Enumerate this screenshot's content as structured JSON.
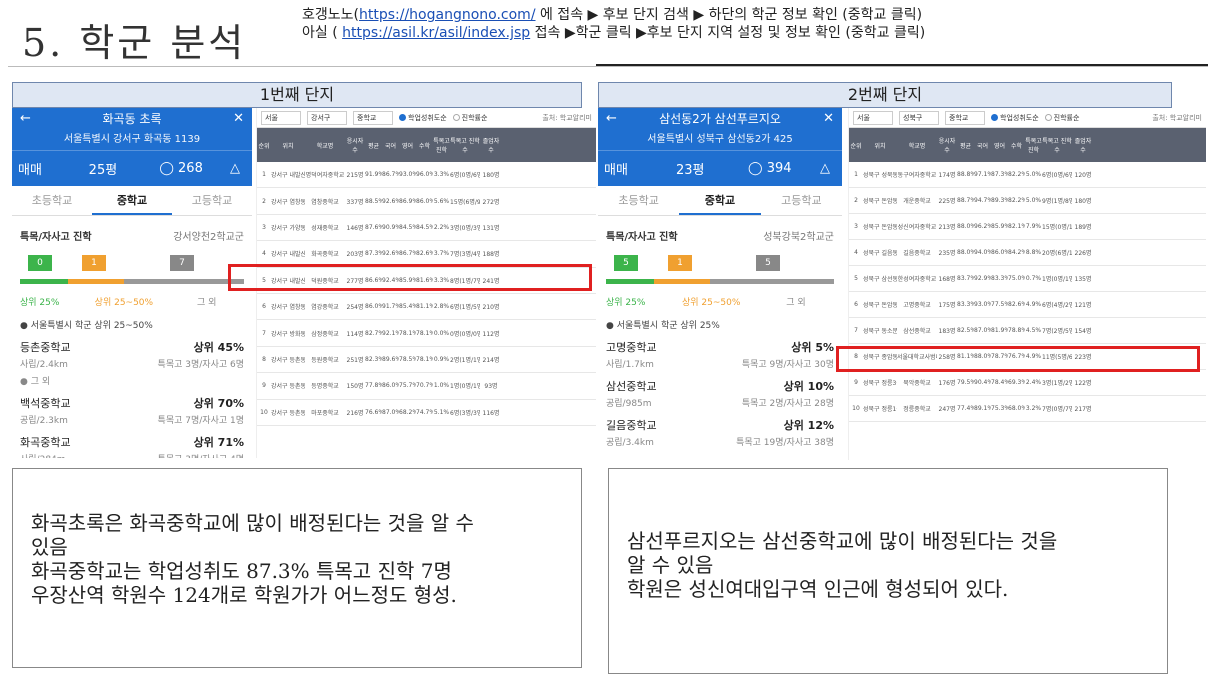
{
  "title": "5. 학군 분석",
  "instructions": {
    "line1_pre": "호갱노노(",
    "line1_link": "https://hogangnono.com/",
    "line1_post": " 에 접속 ▶ 후보 단지 검색 ▶ 하단의 학군 정보 확인 (중학교 클릭)",
    "line2_pre": "아실 ( ",
    "line2_link": "https://asil.kr/asil/index.jsp",
    "line2_post": " 접속 ▶학군 클릭 ▶후보 단지 지역 설정 및 정보 확인 (중학교 클릭)"
  },
  "colors": {
    "accent": "#1f6fd0",
    "highlight": "#e02020",
    "green": "#3cb44b",
    "orange": "#f0a030"
  },
  "panels": [
    {
      "band": "1번째 단지",
      "app": {
        "back": "←",
        "name": "화곡동 초록",
        "close": "✕",
        "address": "서울특별시 강서구 화곡동 1139",
        "deal": "매매",
        "size": "25평",
        "comments": "268",
        "search_icon": "magnifier",
        "bell_icon": "bell",
        "tabs": [
          "초등학교",
          "중학교",
          "고등학교"
        ],
        "section_left": "특목/자사고 진학",
        "section_right": "강서양천2학교군",
        "chips": [
          "0",
          "1",
          "7"
        ],
        "bar_labels": [
          "상위 25%",
          "상위 25~50%",
          "그 외"
        ],
        "note": "● 서울특별시 학군 상위 25~50%",
        "schools": [
          {
            "name": "등촌중학교",
            "rank": "상위 45%",
            "type": "사립/2.4km",
            "info": "특목고 3명/자사고 6명"
          },
          {
            "group": "● 그 외"
          },
          {
            "name": "백석중학교",
            "rank": "상위 70%",
            "type": "공립/2.3km",
            "info": "특목고 7명/자사고 1명"
          },
          {
            "name": "화곡중학교",
            "rank": "상위 71%",
            "type": "사립/284m",
            "info": "특목고 3명/자사고 4명"
          }
        ]
      },
      "table": {
        "region": "서울",
        "district": "강서구",
        "level": "중학교",
        "radio_on": "학업성취도순",
        "radio_off": "진학률순",
        "source": "출처: 학교알리미",
        "headers": [
          "순위",
          "위치",
          "학교명",
          "응시자수",
          "평균",
          "국어",
          "영어",
          "수학",
          "특목고진학",
          "특목고 진학수",
          "졸업자 수"
        ],
        "rows": [
          [
            "1",
            "강서구 내발산동",
            "명덕여자중학교",
            "215명",
            "91.9%",
            "86.7%",
            "93.0%",
            "96.0%",
            "3.3%",
            "6명(0명/6명)",
            "180명"
          ],
          [
            "2",
            "강서구 염창동",
            "염창중학교",
            "337명",
            "88.5%",
            "92.6%",
            "86.9%",
            "86.0%",
            "5.6%",
            "15명(6명/9명)",
            "272명"
          ],
          [
            "3",
            "강서구 가양동",
            "성재중학교",
            "146명",
            "87.6%",
            "90.9%",
            "84.5%",
            "84.5%",
            "2.2%",
            "3명(0명/3명)",
            "131명"
          ],
          [
            "4",
            "강서구 내발산동",
            "화곡중학교",
            "203명",
            "87.3%",
            "92.6%",
            "86.7%",
            "82.6%",
            "3.7%",
            "7명(3명/4명)",
            "188명"
          ],
          [
            "5",
            "강서구 내발산1동",
            "덕원중학교",
            "277명",
            "86.6%",
            "92.4%",
            "85.9%",
            "81.6%",
            "3.3%",
            "8명(1명/7명)",
            "241명"
          ],
          [
            "6",
            "강서구 염창동",
            "염강중학교",
            "254명",
            "86.0%",
            "91.7%",
            "85.4%",
            "81.1%",
            "2.8%",
            "6명(1명/5명)",
            "210명"
          ],
          [
            "7",
            "강서구 방화동",
            "삼정중학교",
            "114명",
            "82.7%",
            "92.1%",
            "78.1%",
            "78.1%",
            "0.0%",
            "0명(0명/0명)",
            "112명"
          ],
          [
            "8",
            "강서구 등촌동",
            "등원중학교",
            "251명",
            "82.3%",
            "89.6%",
            "78.5%",
            "78.1%",
            "0.9%",
            "2명(1명/1명)",
            "214명"
          ],
          [
            "9",
            "강서구 등촌동",
            "등명중학교",
            "150명",
            "77.8%",
            "86.0%",
            "75.7%",
            "70.7%",
            "1.0%",
            "1명(0명/1명)",
            "93명"
          ],
          [
            "10",
            "강서구 등촌동",
            "마포중학교",
            "216명",
            "76.6%",
            "87.0%",
            "68.2%",
            "74.7%",
            "5.1%",
            "6명(3명/3명)",
            "116명"
          ]
        ],
        "highlight_index": 3
      },
      "comment": [
        "화곡초록은 화곡중학교에 많이 배정된다는 것을 알 수",
        "있음",
        "화곡중학교는 학업성취도 87.3% 특목고 진학 7명",
        "우장산역 학원수 124개로 학원가가 어느정도 형성."
      ]
    },
    {
      "band": "2번째 단지",
      "app": {
        "back": "←",
        "name": "삼선동2가 삼선푸르지오",
        "close": "✕",
        "address": "서울특별시 성북구 삼선동2가 425",
        "deal": "매매",
        "size": "23평",
        "comments": "394",
        "search_icon": "magnifier",
        "bell_icon": "bell",
        "tabs": [
          "초등학교",
          "중학교",
          "고등학교"
        ],
        "section_left": "특목/자사고 진학",
        "section_right": "성북강북2학교군",
        "chips": [
          "5",
          "1",
          "5"
        ],
        "bar_labels": [
          "상위 25%",
          "상위 25~50%",
          "그 외"
        ],
        "note": "● 서울특별시 학군 상위 25%",
        "schools": [
          {
            "name": "고명중학교",
            "rank": "상위 5%",
            "type": "사립/1.7km",
            "info": "특목고 9명/자사고 30명"
          },
          {
            "name": "삼선중학교",
            "rank": "상위 10%",
            "type": "공립/985m",
            "info": "특목고 2명/자사고 28명"
          },
          {
            "name": "길음중학교",
            "rank": "상위 12%",
            "type": "공립/3.4km",
            "info": "특목고 19명/자사고 38명"
          }
        ]
      },
      "table": {
        "region": "서울",
        "district": "성북구",
        "level": "중학교",
        "radio_on": "학업성취도순",
        "radio_off": "진학률순",
        "source": "출처: 학교알리미",
        "headers": [
          "순위",
          "위치",
          "학교명",
          "응시자수",
          "평균",
          "국어",
          "영어",
          "수학",
          "특목고진학",
          "특목고 진학수",
          "졸업자 수"
        ],
        "rows": [
          [
            "1",
            "성북구 성북동",
            "동구여자중학교",
            "174명",
            "88.8%",
            "97.1%",
            "87.3%",
            "82.2%",
            "5.0%",
            "6명(0명/6명)",
            "120명"
          ],
          [
            "2",
            "성북구 돈암동",
            "개운중학교",
            "225명",
            "88.7%",
            "94.7%",
            "89.3%",
            "82.2%",
            "5.0%",
            "9명(1명/8명)",
            "180명"
          ],
          [
            "3",
            "성북구 돈암동",
            "성신여자중학교",
            "213명",
            "88.0%",
            "96.2%",
            "85.9%",
            "82.1%",
            "7.9%",
            "15명(0명/15명)",
            "189명"
          ],
          [
            "4",
            "성북구 길음동",
            "길음중학교",
            "235명",
            "88.0%",
            "94.0%",
            "86.0%",
            "84.2%",
            "8.8%",
            "20명(6명/14명)",
            "226명"
          ],
          [
            "5",
            "성북구 삼선동2가",
            "한성여자중학교",
            "168명",
            "83.7%",
            "92.9%",
            "83.3%",
            "75.0%",
            "0.7%",
            "1명(0명/1명)",
            "135명"
          ],
          [
            "6",
            "성북구 돈암동",
            "고명중학교",
            "175명",
            "83.3%",
            "93.0%",
            "77.5%",
            "82.6%",
            "4.9%",
            "6명(4명/2명)",
            "121명"
          ],
          [
            "7",
            "성북구 동소문동1가",
            "삼선중학교",
            "183명",
            "82.5%",
            "87.0%",
            "81.9%",
            "78.8%",
            "4.5%",
            "7명(2명/5명)",
            "154명"
          ],
          [
            "8",
            "성북구 종암동",
            "서울대학교사범대학부설중학교",
            "258명",
            "81.1%",
            "88.0%",
            "78.7%",
            "76.7%",
            "4.9%",
            "11명(5명/6명)",
            "223명"
          ],
          [
            "9",
            "성북구 정릉3동",
            "북악중학교",
            "176명",
            "79.5%",
            "90.4%",
            "78.4%",
            "69.3%",
            "2.4%",
            "3명(1명/2명)",
            "122명"
          ],
          [
            "10",
            "성북구 정릉1동",
            "정릉중학교",
            "247명",
            "77.4%",
            "89.1%",
            "75.3%",
            "68.0%",
            "3.2%",
            "7명(0명/7명)",
            "217명"
          ]
        ],
        "highlight_index": 6
      },
      "comment": [
        "삼선푸르지오는 삼선중학교에 많이 배정된다는 것을",
        "알 수 있음",
        "학원은 성신여대입구역 인근에 형성되어 있다."
      ]
    }
  ]
}
